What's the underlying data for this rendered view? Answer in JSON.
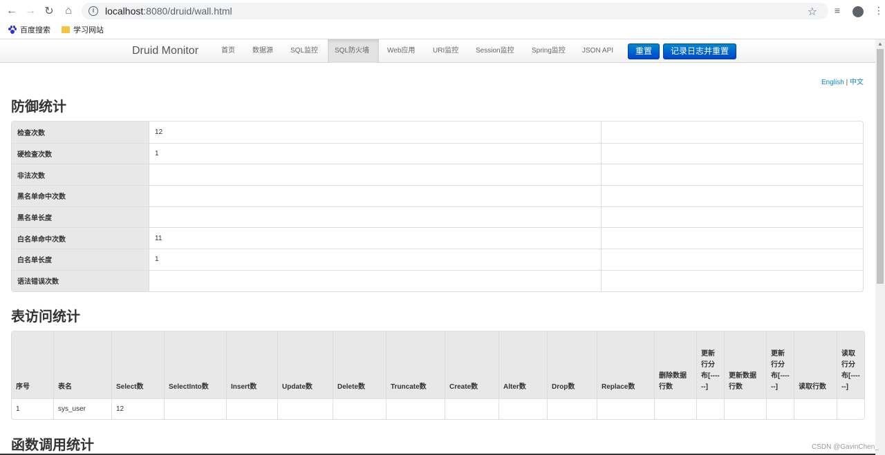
{
  "browser": {
    "url_host": "localhost",
    "url_path": ":8080/druid/wall.html",
    "bookmarks": [
      "百度搜索",
      "学习网站"
    ]
  },
  "navbar": {
    "brand": "Druid Monitor",
    "items": [
      "首页",
      "数据源",
      "SQL监控",
      "SQL防火墙",
      "Web应用",
      "URI监控",
      "Session监控",
      "Spring监控",
      "JSON API"
    ],
    "active_item": "SQL防火墙",
    "reset_button": "重置",
    "log_reset_button": "记录日志并重置"
  },
  "lang": {
    "english": "English",
    "separator": "|",
    "chinese": "中文"
  },
  "defense": {
    "title": "防御统计",
    "rows": [
      {
        "label": "检查次数",
        "value": "12"
      },
      {
        "label": "硬检查次数",
        "value": "1"
      },
      {
        "label": "非法次数",
        "value": ""
      },
      {
        "label": "黑名单命中次数",
        "value": ""
      },
      {
        "label": "黑名单长度",
        "value": ""
      },
      {
        "label": "白名单命中次数",
        "value": "11"
      },
      {
        "label": "白名单长度",
        "value": "1"
      },
      {
        "label": "语法错误次数",
        "value": ""
      }
    ]
  },
  "table_access": {
    "title": "表访问统计",
    "columns": [
      "序号",
      "表名",
      "Select数",
      "SelectInto数",
      "Insert数",
      "Update数",
      "Delete数",
      "Truncate数",
      "Create数",
      "Alter数",
      "Drop数",
      "Replace数",
      "删除数据行数",
      "更新行分布[------]",
      "更新数据行数",
      "更新行分布[------]",
      "读取行数",
      "读取行分布[------]"
    ],
    "rows": [
      [
        "1",
        "sys_user",
        "12",
        "",
        "",
        "",
        "",
        "",
        "",
        "",
        "",
        "",
        "",
        "",
        "",
        "",
        "",
        ""
      ]
    ]
  },
  "function": {
    "title": "函数调用统计"
  },
  "watermark": "CSDN @GavinChen_"
}
